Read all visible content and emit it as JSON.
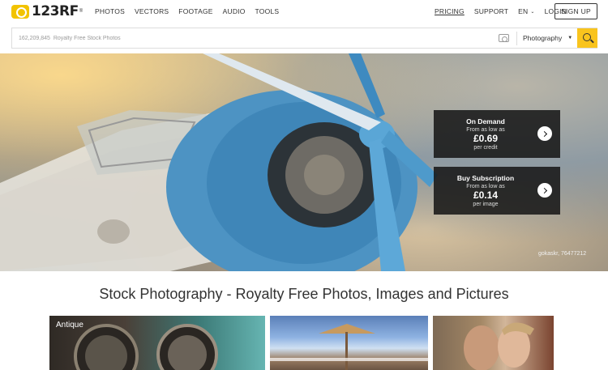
{
  "brand": {
    "name": "123RF",
    "reg": "®"
  },
  "nav": {
    "items": [
      "PHOTOS",
      "VECTORS",
      "FOOTAGE",
      "AUDIO",
      "TOOLS"
    ]
  },
  "right_nav": {
    "pricing": "PRICING",
    "support": "SUPPORT",
    "language": "EN",
    "login": "LOGIN",
    "signup": "SIGN UP"
  },
  "search": {
    "placeholder": "162,209,845  Royalty Free Stock Photos",
    "category": "Photography",
    "accent": "#f9c41d"
  },
  "hero": {
    "credit": "gokaskr, 76477212",
    "offers": [
      {
        "title": "On Demand",
        "sub": "From as low as",
        "price": "£0.69",
        "unit": "per credit"
      },
      {
        "title": "Buy Subscription",
        "sub": "From as low as",
        "price": "£0.14",
        "unit": "per image"
      }
    ]
  },
  "main": {
    "title": "Stock Photography - Royalty Free Photos, Images and Pictures",
    "tiles": [
      {
        "label": "Antique"
      },
      {
        "label": ""
      },
      {
        "label": ""
      }
    ]
  },
  "icons": {
    "logo": "camera-logo-icon",
    "camera": "camera-icon",
    "search": "search-icon",
    "arrow": "chevron-right-icon",
    "caret": "caret-down-icon"
  }
}
